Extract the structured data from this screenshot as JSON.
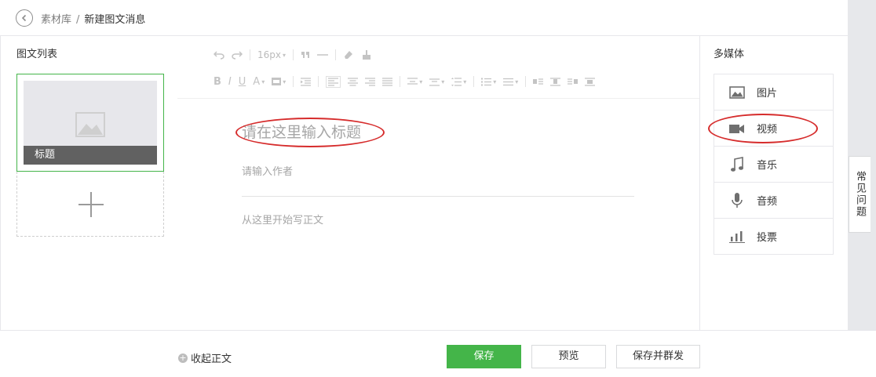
{
  "breadcrumb": {
    "parent": "素材库",
    "separator": "/",
    "current": "新建图文消息"
  },
  "left_panel": {
    "title": "图文列表",
    "card_caption": "标题"
  },
  "toolbar": {
    "font_size": "16px"
  },
  "editor": {
    "title_placeholder": "请在这里输入标题",
    "author_placeholder": "请输入作者",
    "body_placeholder": "从这里开始写正文"
  },
  "media_panel": {
    "title": "多媒体",
    "items": [
      {
        "label": "图片",
        "icon": "image-icon"
      },
      {
        "label": "视频",
        "icon": "video-icon"
      },
      {
        "label": "音乐",
        "icon": "music-icon"
      },
      {
        "label": "音频",
        "icon": "microphone-icon"
      },
      {
        "label": "投票",
        "icon": "vote-chart-icon"
      }
    ]
  },
  "faq": {
    "label": "常见问题"
  },
  "footer": {
    "collapse_label": "收起正文",
    "save_label": "保存",
    "preview_label": "预览",
    "publish_label": "保存并群发"
  },
  "colors": {
    "accent_green": "#44b549",
    "annotation_red": "#d62c2c",
    "caption_bg": "#616161"
  }
}
